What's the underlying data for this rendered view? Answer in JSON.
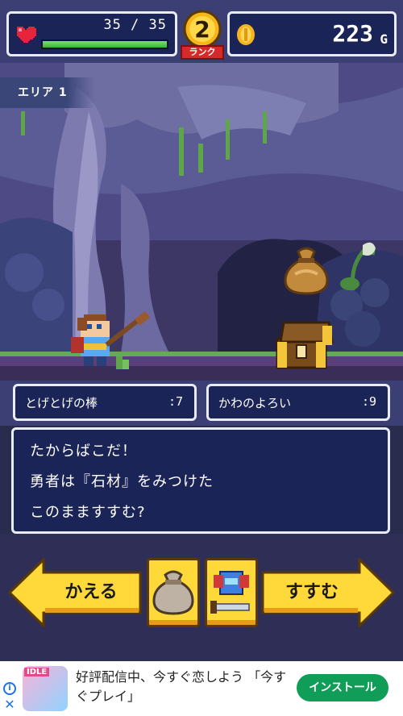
{
  "hud": {
    "hp_text": "35 / 35",
    "hp_fraction": 1.0,
    "rank_number": "2",
    "rank_label": "ランク",
    "gold_value": "223",
    "gold_unit": "G"
  },
  "scene": {
    "area_label": "エリア 1",
    "icons": [
      "cave-background",
      "hero-sprite",
      "spear-icon",
      "coin-bag-icon",
      "treasure-chest-icon",
      "hanging-plant"
    ]
  },
  "equipment": {
    "weapon_name": "とげとげの棒",
    "weapon_value": ":7",
    "armor_name": "かわのよろい",
    "armor_value": ":9"
  },
  "message": {
    "lines": [
      "たからばこだ！",
      "勇者は『石材』をみつけた",
      "このまますすむ?"
    ]
  },
  "controls": {
    "back_label": "かえる",
    "forward_label": "すすむ",
    "bag_icon": "item-bag-icon",
    "equip_icon": "armor-sword-icon"
  },
  "ad": {
    "text": "好評配信中、今すぐ恋しよう 「今すぐプレイ」",
    "install_label": "インストール",
    "thumb_label": "IDLE"
  },
  "colors": {
    "panel_bg": "#1b2457",
    "panel_border": "#e9ecf6",
    "button_yellow": "#ffd93a",
    "hp_green": "#37b33a",
    "ad_green": "#0f9d58"
  }
}
